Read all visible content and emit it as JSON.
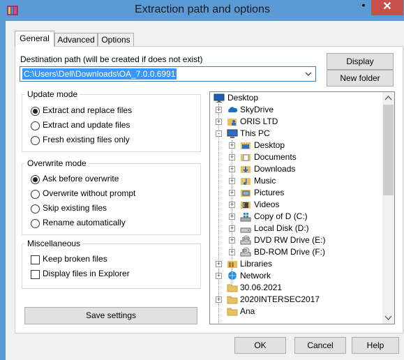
{
  "window": {
    "title": "Extraction path and options",
    "minimize_glyph": "•",
    "close_glyph": "✕"
  },
  "tabs": [
    {
      "label": "General",
      "active": true
    },
    {
      "label": "Advanced",
      "active": false
    },
    {
      "label": "Options",
      "active": false
    }
  ],
  "destination": {
    "label": "Destination path (will be created if does not exist)",
    "value": "C:\\Users\\Dell\\Downloads\\OA_7.0.0.6991",
    "display_button": "Display",
    "new_folder_button": "New folder"
  },
  "update_mode": {
    "title": "Update mode",
    "options": [
      {
        "label": "Extract and replace files",
        "selected": true
      },
      {
        "label": "Extract and update files",
        "selected": false
      },
      {
        "label": "Fresh existing files only",
        "selected": false
      }
    ]
  },
  "overwrite_mode": {
    "title": "Overwrite mode",
    "options": [
      {
        "label": "Ask before overwrite",
        "selected": true
      },
      {
        "label": "Overwrite without prompt",
        "selected": false
      },
      {
        "label": "Skip existing files",
        "selected": false
      },
      {
        "label": "Rename automatically",
        "selected": false
      }
    ]
  },
  "miscellaneous": {
    "title": "Miscellaneous",
    "options": [
      {
        "label": "Keep broken files",
        "checked": false
      },
      {
        "label": "Display files in Explorer",
        "checked": false
      }
    ]
  },
  "save_settings_button": "Save settings",
  "tree": {
    "items": [
      {
        "label": "Desktop",
        "icon": "desktop-icon",
        "level": 0,
        "expander": ""
      },
      {
        "label": "SkyDrive",
        "icon": "cloud-icon",
        "level": 1,
        "expander": "+"
      },
      {
        "label": "ORIS LTD",
        "icon": "user-folder-icon",
        "level": 1,
        "expander": "+"
      },
      {
        "label": "This PC",
        "icon": "computer-icon",
        "level": 1,
        "expander": "-"
      },
      {
        "label": "Desktop",
        "icon": "desktop-folder-icon",
        "level": 2,
        "expander": "+"
      },
      {
        "label": "Documents",
        "icon": "documents-icon",
        "level": 2,
        "expander": "+"
      },
      {
        "label": "Downloads",
        "icon": "downloads-icon",
        "level": 2,
        "expander": "+"
      },
      {
        "label": "Music",
        "icon": "music-icon",
        "level": 2,
        "expander": "+"
      },
      {
        "label": "Pictures",
        "icon": "pictures-icon",
        "level": 2,
        "expander": "+"
      },
      {
        "label": "Videos",
        "icon": "videos-icon",
        "level": 2,
        "expander": "+"
      },
      {
        "label": "Copy of D (C:)",
        "icon": "windows-drive-icon",
        "level": 2,
        "expander": "+"
      },
      {
        "label": "Local Disk (D:)",
        "icon": "hard-drive-icon",
        "level": 2,
        "expander": "+"
      },
      {
        "label": "DVD RW Drive (E:)",
        "icon": "dvd-drive-icon",
        "level": 2,
        "expander": "+"
      },
      {
        "label": "BD-ROM Drive (F:)",
        "icon": "bd-drive-icon",
        "level": 2,
        "expander": "+"
      },
      {
        "label": "Libraries",
        "icon": "libraries-icon",
        "level": 1,
        "expander": "+"
      },
      {
        "label": "Network",
        "icon": "network-icon",
        "level": 1,
        "expander": "+"
      },
      {
        "label": "30.06.2021",
        "icon": "folder-icon",
        "level": 1,
        "expander": ""
      },
      {
        "label": "2020INTERSEC2017",
        "icon": "folder-icon",
        "level": 1,
        "expander": "+"
      },
      {
        "label": "Ana",
        "icon": "folder-icon",
        "level": 1,
        "expander": ""
      }
    ]
  },
  "footer": {
    "ok": "OK",
    "cancel": "Cancel",
    "help": "Help"
  },
  "colors": {
    "title_bar": "#5b9bd5",
    "close_button": "#c7504b",
    "selection": "#3399ff",
    "folder": "#e8c064"
  }
}
